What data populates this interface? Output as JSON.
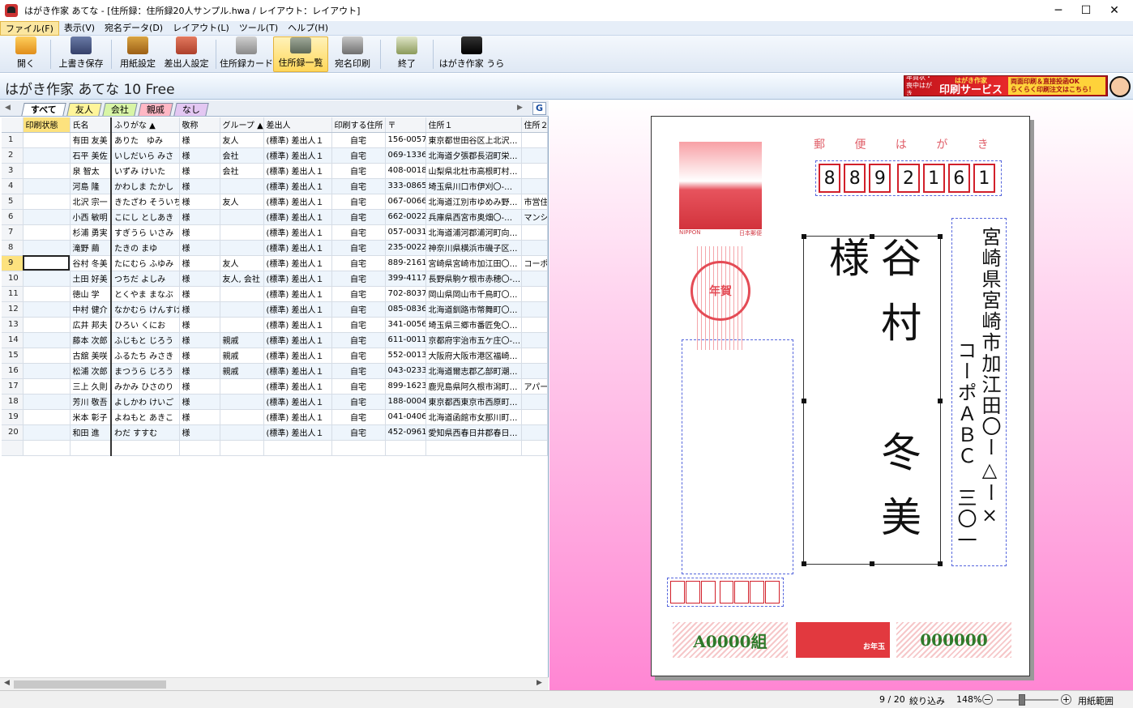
{
  "window": {
    "title": "はがき作家 あてな - [住所録：住所録20人サンプル.hwa / レイアウト：レイアウト]",
    "minimize": "─",
    "maximize": "☐",
    "close": "✕"
  },
  "menu": [
    {
      "label": "ファイル(F)"
    },
    {
      "label": "表示(V)"
    },
    {
      "label": "宛名データ(D)"
    },
    {
      "label": "レイアウト(L)"
    },
    {
      "label": "ツール(T)"
    },
    {
      "label": "ヘルプ(H)"
    }
  ],
  "toolbar": {
    "open": "開く",
    "save": "上書き保存",
    "paper": "用紙設定",
    "sender": "差出人設定",
    "card": "住所録カード",
    "list": "住所録一覧",
    "print": "宛名印刷",
    "exit": "終了",
    "app": "はがき作家 うら"
  },
  "app_title": "はがき作家 あてな 10 Free",
  "ad": {
    "line1": "年賀状・",
    "line2": "喪中はがき",
    "brand_small": "はがき作家",
    "brand": "印刷サービス",
    "note1": "両面印刷＆直接投函OK",
    "note2": "らくらく印刷注文はこちら！"
  },
  "tabs": [
    "すべて",
    "友人",
    "会社",
    "親戚",
    "なし"
  ],
  "g_button": "G",
  "columns": [
    "印刷状態",
    "氏名",
    "ふりがな ▲",
    "敬称",
    "グループ ▲",
    "差出人",
    "印刷する住所",
    "〒",
    "住所１",
    "住所２"
  ],
  "rows": [
    [
      "1",
      "",
      "有田 友美",
      "ありた　ゆみ",
      "様",
      "友人",
      "(標準) 差出人１",
      "自宅",
      "156-0057",
      "東京都世田谷区上北沢…",
      ""
    ],
    [
      "2",
      "",
      "石平 美佐",
      "いしだいら みさ",
      "様",
      "会社",
      "(標準) 差出人１",
      "自宅",
      "069-1336",
      "北海道夕張郡長沼町栄…",
      ""
    ],
    [
      "3",
      "",
      "泉 智太",
      "いずみ けいた",
      "様",
      "会社",
      "(標準) 差出人１",
      "自宅",
      "408-0018",
      "山梨県北杜市高根町村…",
      ""
    ],
    [
      "4",
      "",
      "河島 隆",
      "かわしま たかし",
      "様",
      "",
      "(標準) 差出人１",
      "自宅",
      "333-0865",
      "埼玉県川口市伊刈〇-…",
      ""
    ],
    [
      "5",
      "",
      "北沢 宗一",
      "きたざわ そういち",
      "様",
      "友人",
      "(標準) 差出人１",
      "自宅",
      "067-0066",
      "北海道江別市ゆめみ野…",
      "市営住"
    ],
    [
      "6",
      "",
      "小西 敏明",
      "こにし としあき",
      "様",
      "",
      "(標準) 差出人１",
      "自宅",
      "662-0022",
      "兵庫県西宮市奥畑〇-…",
      "マンシ"
    ],
    [
      "7",
      "",
      "杉浦 勇実",
      "すぎうら いさみ",
      "様",
      "",
      "(標準) 差出人１",
      "自宅",
      "057-0031",
      "北海道浦河郡浦河町向…",
      ""
    ],
    [
      "8",
      "",
      "滝野 繭",
      "たきの まゆ",
      "様",
      "",
      "(標準) 差出人１",
      "自宅",
      "235-0022",
      "神奈川県横浜市磯子区…",
      ""
    ],
    [
      "9",
      "",
      "谷村 冬美",
      "たにむら ふゆみ",
      "様",
      "友人",
      "(標準) 差出人１",
      "自宅",
      "889-2161",
      "宮崎県宮崎市加江田〇…",
      "コーポA"
    ],
    [
      "10",
      "",
      "土田 好美",
      "つちだ よしみ",
      "様",
      "友人, 会社",
      "(標準) 差出人１",
      "自宅",
      "399-4117",
      "長野県駒ケ根市赤穂〇-…",
      ""
    ],
    [
      "11",
      "",
      "徳山 学",
      "とくやま まなぶ",
      "様",
      "",
      "(標準) 差出人１",
      "自宅",
      "702-8037",
      "岡山県岡山市千鳥町〇…",
      ""
    ],
    [
      "12",
      "",
      "中村 健介",
      "なかむら けんすけ",
      "様",
      "",
      "(標準) 差出人１",
      "自宅",
      "085-0836",
      "北海道釧路市幣舞町〇…",
      ""
    ],
    [
      "13",
      "",
      "広井 邦夫",
      "ひろい くにお",
      "様",
      "",
      "(標準) 差出人１",
      "自宅",
      "341-0056",
      "埼玉県三郷市番匠免〇…",
      ""
    ],
    [
      "14",
      "",
      "藤本 次郎",
      "ふじもと じろう",
      "様",
      "親戚",
      "(標準) 差出人１",
      "自宅",
      "611-0011",
      "京都府宇治市五ケ庄〇-…",
      ""
    ],
    [
      "15",
      "",
      "古舘 美咲",
      "ふるたち みさき",
      "様",
      "親戚",
      "(標準) 差出人１",
      "自宅",
      "552-0013",
      "大阪府大阪市港区福崎…",
      ""
    ],
    [
      "16",
      "",
      "松浦 次郎",
      "まつうら じろう",
      "様",
      "親戚",
      "(標準) 差出人１",
      "自宅",
      "043-0233",
      "北海道爾志郡乙部町潮…",
      ""
    ],
    [
      "17",
      "",
      "三上 久則",
      "みかみ ひさのり",
      "様",
      "",
      "(標準) 差出人１",
      "自宅",
      "899-1623",
      "鹿児島県阿久根市潟町…",
      "アパート"
    ],
    [
      "18",
      "",
      "芳川 敬吾",
      "よしかわ けいご",
      "様",
      "",
      "(標準) 差出人１",
      "自宅",
      "188-0004",
      "東京都西東京市西原町…",
      ""
    ],
    [
      "19",
      "",
      "米本 彰子",
      "よねもと あきこ",
      "様",
      "",
      "(標準) 差出人１",
      "自宅",
      "041-0406",
      "北海道函館市女那川町…",
      ""
    ],
    [
      "20",
      "",
      "和田 進",
      "わだ すすむ",
      "様",
      "",
      "(標準) 差出人１",
      "自宅",
      "452-0961",
      "愛知県西春日井郡春日…",
      ""
    ]
  ],
  "selected_row": 9,
  "preview": {
    "header": "郵 便 は が き",
    "stamp_brand": "NIPPON",
    "stamp_value": "日本郵便",
    "seal_text": "年賀",
    "zip": [
      "8",
      "8",
      "9",
      "2",
      "1",
      "6",
      "1"
    ],
    "name": "谷村　冬美　様",
    "address1": "宮崎県宮崎市加江田〇ー△ー×",
    "address2": "コーポＡＢＣ　三〇一",
    "lottery_left": "A0000組",
    "lottery_mid": "お年玉",
    "lottery_right": "000000"
  },
  "status": {
    "position": "9 / 20",
    "filter": "絞り込み",
    "zoom": "148%",
    "fit": "用紙範囲"
  }
}
